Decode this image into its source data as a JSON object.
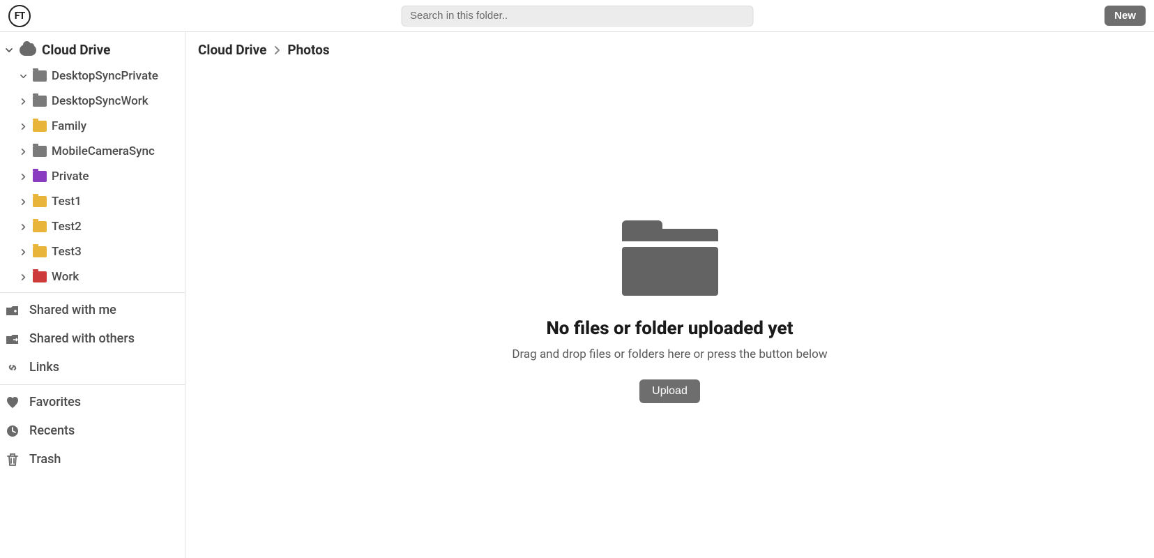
{
  "header": {
    "search_placeholder": "Search in this folder..",
    "new_button": "New",
    "logo_text": "FT"
  },
  "sidebar": {
    "root_label": "Cloud Drive",
    "root_expanded": true,
    "folders": [
      {
        "label": "DesktopSyncPrivate",
        "color": "gray",
        "expanded": true
      },
      {
        "label": "DesktopSyncWork",
        "color": "gray",
        "expanded": false
      },
      {
        "label": "Family",
        "color": "yellow",
        "expanded": false
      },
      {
        "label": "MobileCameraSync",
        "color": "gray",
        "expanded": false
      },
      {
        "label": "Private",
        "color": "purple",
        "expanded": false
      },
      {
        "label": "Test1",
        "color": "yellow",
        "expanded": false
      },
      {
        "label": "Test2",
        "color": "yellow",
        "expanded": false
      },
      {
        "label": "Test3",
        "color": "yellow",
        "expanded": false
      },
      {
        "label": "Work",
        "color": "red",
        "expanded": false
      }
    ],
    "nav": {
      "shared_with_me": "Shared with me",
      "shared_with_others": "Shared with others",
      "links": "Links",
      "favorites": "Favorites",
      "recents": "Recents",
      "trash": "Trash"
    }
  },
  "breadcrumb": {
    "items": [
      "Cloud Drive",
      "Photos"
    ]
  },
  "empty_state": {
    "title": "No files or folder uploaded yet",
    "subtitle": "Drag and drop files or folders here or press the button below",
    "upload_button": "Upload"
  }
}
